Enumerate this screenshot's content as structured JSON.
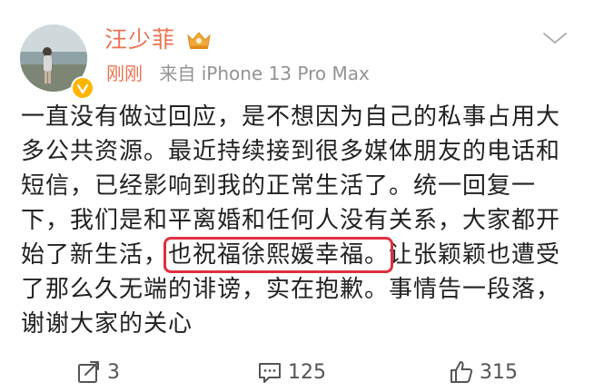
{
  "post": {
    "author": {
      "name": "汪少菲",
      "verified": true,
      "badge_color": "#ffb400",
      "name_color": "#eb7350",
      "vip_icon": "crown-icon"
    },
    "meta": {
      "time": "刚刚",
      "source": "来自 iPhone 13 Pro Max"
    },
    "menu_icon": "chevron-down-icon",
    "body": {
      "before": "一直没有做过回应，是不想因为自己的私事占用大多公共资源。最近持续接到很多媒体朋友的电话和短信，已经影响到我的正常生活了。统一回复一下，我们是和平离婚和任何人没有关系，大家都开始了新生活，",
      "highlighted": "也祝福徐熙媛幸福。",
      "after": "让张颖颖也遭受了那么久无端的诽谤，实在抱歉。事情告一段落，谢谢大家的关心",
      "highlight_color": "#e03040"
    },
    "actions": {
      "repost": {
        "icon": "share-icon",
        "count": "3"
      },
      "comment": {
        "icon": "comment-icon",
        "count": "125"
      },
      "like": {
        "icon": "thumbs-up-icon",
        "count": "315"
      }
    }
  }
}
